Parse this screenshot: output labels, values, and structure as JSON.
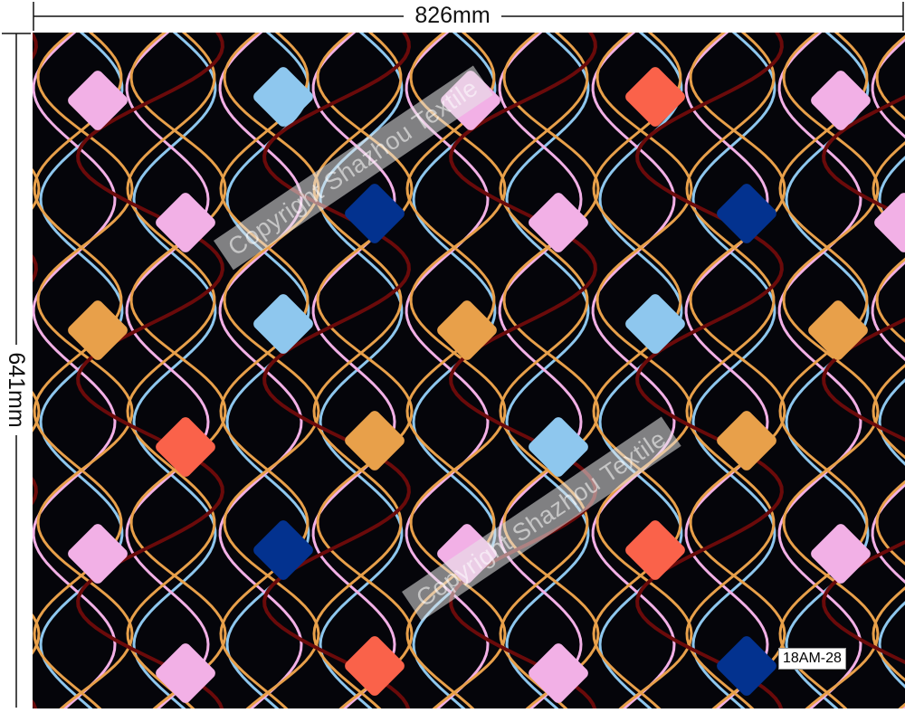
{
  "dimensions": {
    "width_label": "826mm",
    "height_label": "641mm"
  },
  "watermark_text": "Copyright Shazhou Textile",
  "pattern_code": "18AM-28",
  "colors": {
    "background": "#05050a",
    "light_blue": "#8ec7ee",
    "pink": "#f2b0e6",
    "orange": "#e8a04a",
    "coral": "#fa624a",
    "navy": "#03328f",
    "dark_red": "#6a0a0a",
    "gold_line": "#e8a04a"
  }
}
